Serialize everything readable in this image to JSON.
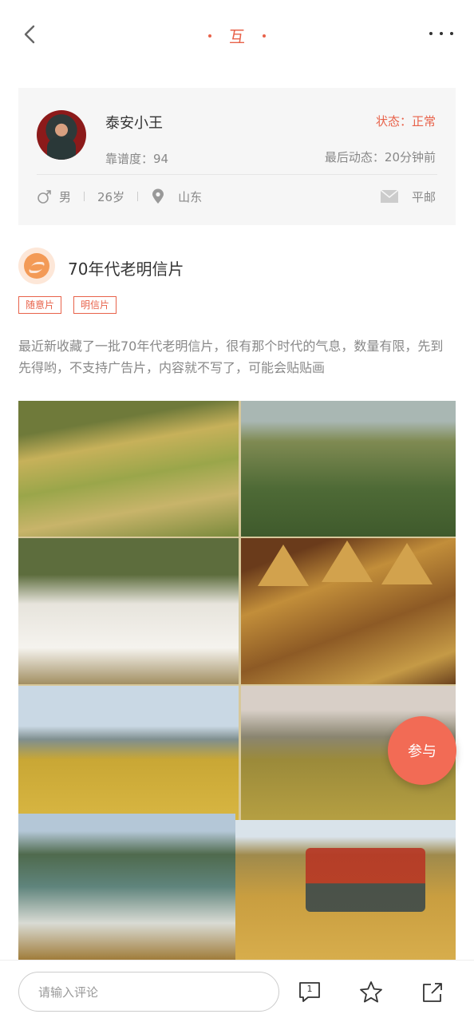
{
  "header": {
    "title": "互"
  },
  "user": {
    "name": "泰安小王",
    "status": "状态：正常",
    "reliability": "靠谱度：94",
    "last_active": "最后动态：20分钟前",
    "gender": "男",
    "age": "26岁",
    "location": "山东",
    "mail_type": "平邮"
  },
  "post": {
    "title": "70年代老明信片",
    "tags": [
      "随意片",
      "明信片"
    ],
    "text": "最近新收藏了一批70年代老明信片，很有那个时代的气息，数量有限，先到先得哟，不支持广告片，内容就不写了，可能会贴贴画"
  },
  "fab": {
    "label": "参与"
  },
  "bottom_bar": {
    "comment_placeholder": "请输入评论",
    "comment_count": "1"
  },
  "colors": {
    "accent": "#e8624a",
    "fab": "#f26b55"
  },
  "icons": [
    "back-icon",
    "more-icon",
    "male-icon",
    "location-icon",
    "mail-icon",
    "comment-icon",
    "star-icon",
    "share-icon"
  ]
}
